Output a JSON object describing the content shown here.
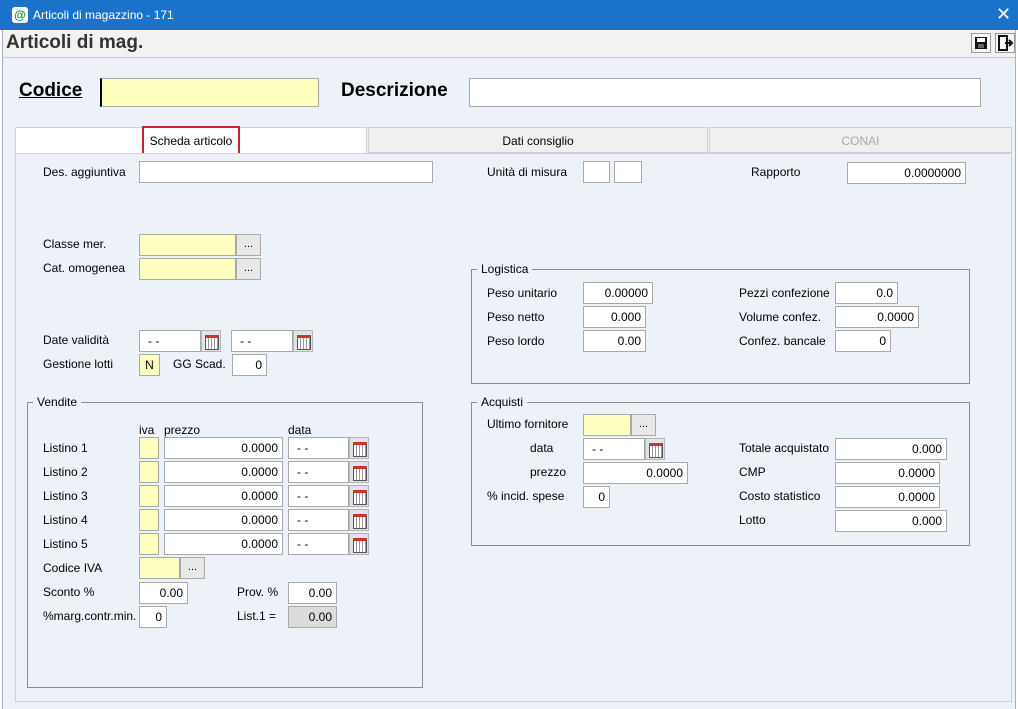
{
  "window": {
    "title": "Articoli di magazzino - 171",
    "close_glyph": "✕"
  },
  "header": {
    "form_title": "Articoli di mag."
  },
  "top": {
    "codice_label": "Codice",
    "codice_value": "",
    "descrizione_label": "Descrizione",
    "descrizione_value": ""
  },
  "tabs": [
    {
      "label": "Scheda articolo",
      "active": true
    },
    {
      "label": "Dati consiglio",
      "active": false
    },
    {
      "label": "CONAI",
      "active": false,
      "disabled": true
    }
  ],
  "general": {
    "des_aggiuntiva_label": "Des. aggiuntiva",
    "des_aggiuntiva_value": "",
    "unita_misura_label": "Unità di misura",
    "rapporto_label": "Rapporto",
    "rapporto_value": "0.0000000",
    "classe_mer_label": "Classe mer.",
    "cat_omogenea_label": "Cat. omogenea",
    "date_validita_label": "Date validità",
    "date_from": "- -",
    "date_to": "- -",
    "gestione_lotti_label": "Gestione lotti",
    "gestione_lotti_value": "N",
    "gg_scad_label": "GG Scad.",
    "gg_scad_value": "0",
    "ellipsis": "..."
  },
  "logistica": {
    "title": "Logistica",
    "peso_unitario_label": "Peso unitario",
    "peso_unitario": "0.00000",
    "peso_netto_label": "Peso netto",
    "peso_netto": "0.000",
    "peso_lordo_label": "Peso lordo",
    "peso_lordo": "0.00",
    "pezzi_confezione_label": "Pezzi confezione",
    "pezzi_confezione": "0.0",
    "volume_confez_label": "Volume confez.",
    "volume_confez": "0.0000",
    "confez_bancale_label": "Confez. bancale",
    "confez_bancale": "0"
  },
  "vendite": {
    "title": "Vendite",
    "col_iva": "iva",
    "col_prezzo": "prezzo",
    "col_data": "data",
    "listini": [
      {
        "label": "Listino 1",
        "prezzo": "0.0000",
        "data": "- -"
      },
      {
        "label": "Listino 2",
        "prezzo": "0.0000",
        "data": "- -"
      },
      {
        "label": "Listino 3",
        "prezzo": "0.0000",
        "data": "- -"
      },
      {
        "label": "Listino 4",
        "prezzo": "0.0000",
        "data": "- -"
      },
      {
        "label": "Listino 5",
        "prezzo": "0.0000",
        "data": "- -"
      }
    ],
    "codice_iva_label": "Codice IVA",
    "sconto_label": "Sconto %",
    "sconto_value": "0.00",
    "prov_label": "Prov. %",
    "prov_value": "0.00",
    "marg_label": "%marg.contr.min.",
    "marg_value": "0",
    "list1_label": "List.1 =",
    "list1_value": "0.00"
  },
  "acquisti": {
    "title": "Acquisti",
    "ultimo_fornitore_label": "Ultimo  fornitore",
    "data_label": "data",
    "data_value": "- -",
    "prezzo_label": "prezzo",
    "prezzo_value": "0.0000",
    "incid_label": "% incid. spese",
    "incid_value": "0",
    "totale_label": "Totale acquistato",
    "totale_value": "0.000",
    "cmp_label": "CMP",
    "cmp_value": "0.0000",
    "costo_label": "Costo statistico",
    "costo_value": "0.0000",
    "lotto_label": "Lotto",
    "lotto_value": "0.000"
  },
  "colors": {
    "titlebar": "#1a73c9",
    "highlight": "#d0202a",
    "required_field": "#ffffc0"
  }
}
